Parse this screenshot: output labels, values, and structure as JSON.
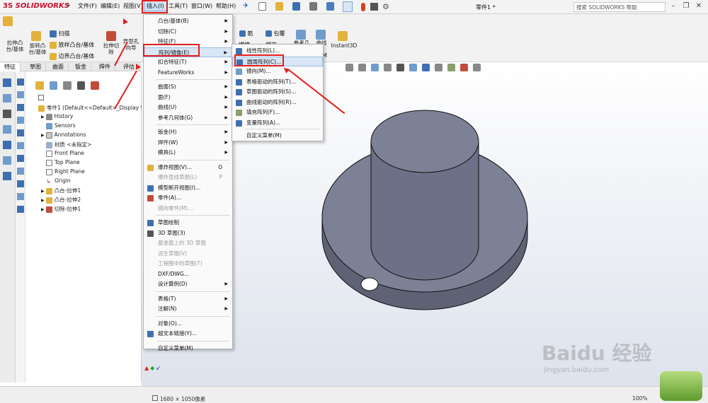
{
  "app": {
    "logo": "SOLIDWORKS",
    "logo_prefix": "3S",
    "document_title": "零件1 *",
    "search_placeholder": "搜索 SOLIDWORKS 帮助"
  },
  "menubar": [
    "文件(F)",
    "编辑(E)",
    "视图(V)",
    "插入(I)",
    "工具(T)",
    "窗口(W)",
    "帮助(H)"
  ],
  "commands": [
    {
      "label": "拉伸凸\n台/基体"
    },
    {
      "label": "旋转凸\n台/基体"
    },
    {
      "label": "扫描"
    },
    {
      "label": "放样凸台/基体"
    },
    {
      "label": "边界凸台/基体"
    },
    {
      "label": "拉伸切\n除"
    },
    {
      "label": "异型孔\n向导"
    },
    {
      "label": "筋"
    },
    {
      "label": "包覆"
    },
    {
      "label": "拔模"
    },
    {
      "label": "相交"
    },
    {
      "label": "参考几"
    },
    {
      "label": "曲线"
    },
    {
      "label": "Instant3D"
    }
  ],
  "tabs": [
    "特征",
    "草图",
    "曲面",
    "钣金",
    "焊件",
    "评估"
  ],
  "tree": {
    "root": "零件1  (Default<<Default>_Display Sta",
    "items": [
      "History",
      "Sensors",
      "Annotations",
      "材质 <未指定>",
      "Front Plane",
      "Top Plane",
      "Right Plane",
      "Origin",
      "凸台-拉伸1",
      "凸台-拉伸2",
      "切除-拉伸1"
    ]
  },
  "insert_menu": {
    "items": [
      {
        "label": "凸台/基体(B)",
        "arrow": true
      },
      {
        "label": "切除(C)",
        "arrow": true
      },
      {
        "label": "特征(F)",
        "arrow": true
      },
      {
        "label": "阵列/镜像(E)",
        "arrow": true
      },
      {
        "label": "扣合特征(T)",
        "arrow": true
      },
      {
        "label": "FeatureWorks",
        "arrow": true
      },
      {
        "label": "曲面(S)",
        "arrow": true
      },
      {
        "label": "面(F)",
        "arrow": true
      },
      {
        "label": "曲线(U)",
        "arrow": true
      },
      {
        "label": "参考几何体(G)",
        "arrow": true
      },
      {
        "label": "钣金(H)",
        "arrow": true
      },
      {
        "label": "焊件(W)",
        "arrow": true
      },
      {
        "label": "模具(L)",
        "arrow": true
      },
      {
        "label": "爆炸视图(V)...",
        "key": "O"
      },
      {
        "label": "爆炸直线草图(L)",
        "key": "P",
        "disabled": true
      },
      {
        "label": "模型断开视图(I)..."
      },
      {
        "label": "零件(A)..."
      },
      {
        "label": "镜向零件(M)...",
        "disabled": true
      },
      {
        "label": "草图绘制"
      },
      {
        "label": "3D 草图(3)"
      },
      {
        "label": "基准面上的 3D 草图",
        "disabled": true
      },
      {
        "label": "派生草图(V)",
        "disabled": true
      },
      {
        "label": "工程图中的草图(T)",
        "disabled": true
      },
      {
        "label": "DXF/DWG..."
      },
      {
        "label": "设计算例(D)",
        "arrow": true
      },
      {
        "label": "表格(T)",
        "arrow": true
      },
      {
        "label": "注解(N)",
        "arrow": true
      },
      {
        "label": "对象(O)..."
      },
      {
        "label": "超文本链接(Y)..."
      },
      {
        "label": "自定义菜单(M)"
      }
    ]
  },
  "pattern_menu": {
    "items": [
      "线性阵列(L)...",
      "圆周阵列(C)...",
      "镜向(M)...",
      "表格驱动的阵列(T)...",
      "草图驱动的阵列(S)...",
      "曲线驱动的阵列(R)...",
      "填充阵列(F)...",
      "变量阵列(A)...",
      "自定义菜单(M)"
    ],
    "m_key": "M"
  },
  "status": {
    "resolution": "1680 × 1050像素",
    "zoom": "100%"
  },
  "watermark": {
    "brand": "Baidu 经验",
    "url": "jingyan.baidu.com"
  },
  "colors": {
    "accent": "#e21d1d",
    "model": "#7d8196",
    "viewport_bottom": "#dde2ec"
  }
}
